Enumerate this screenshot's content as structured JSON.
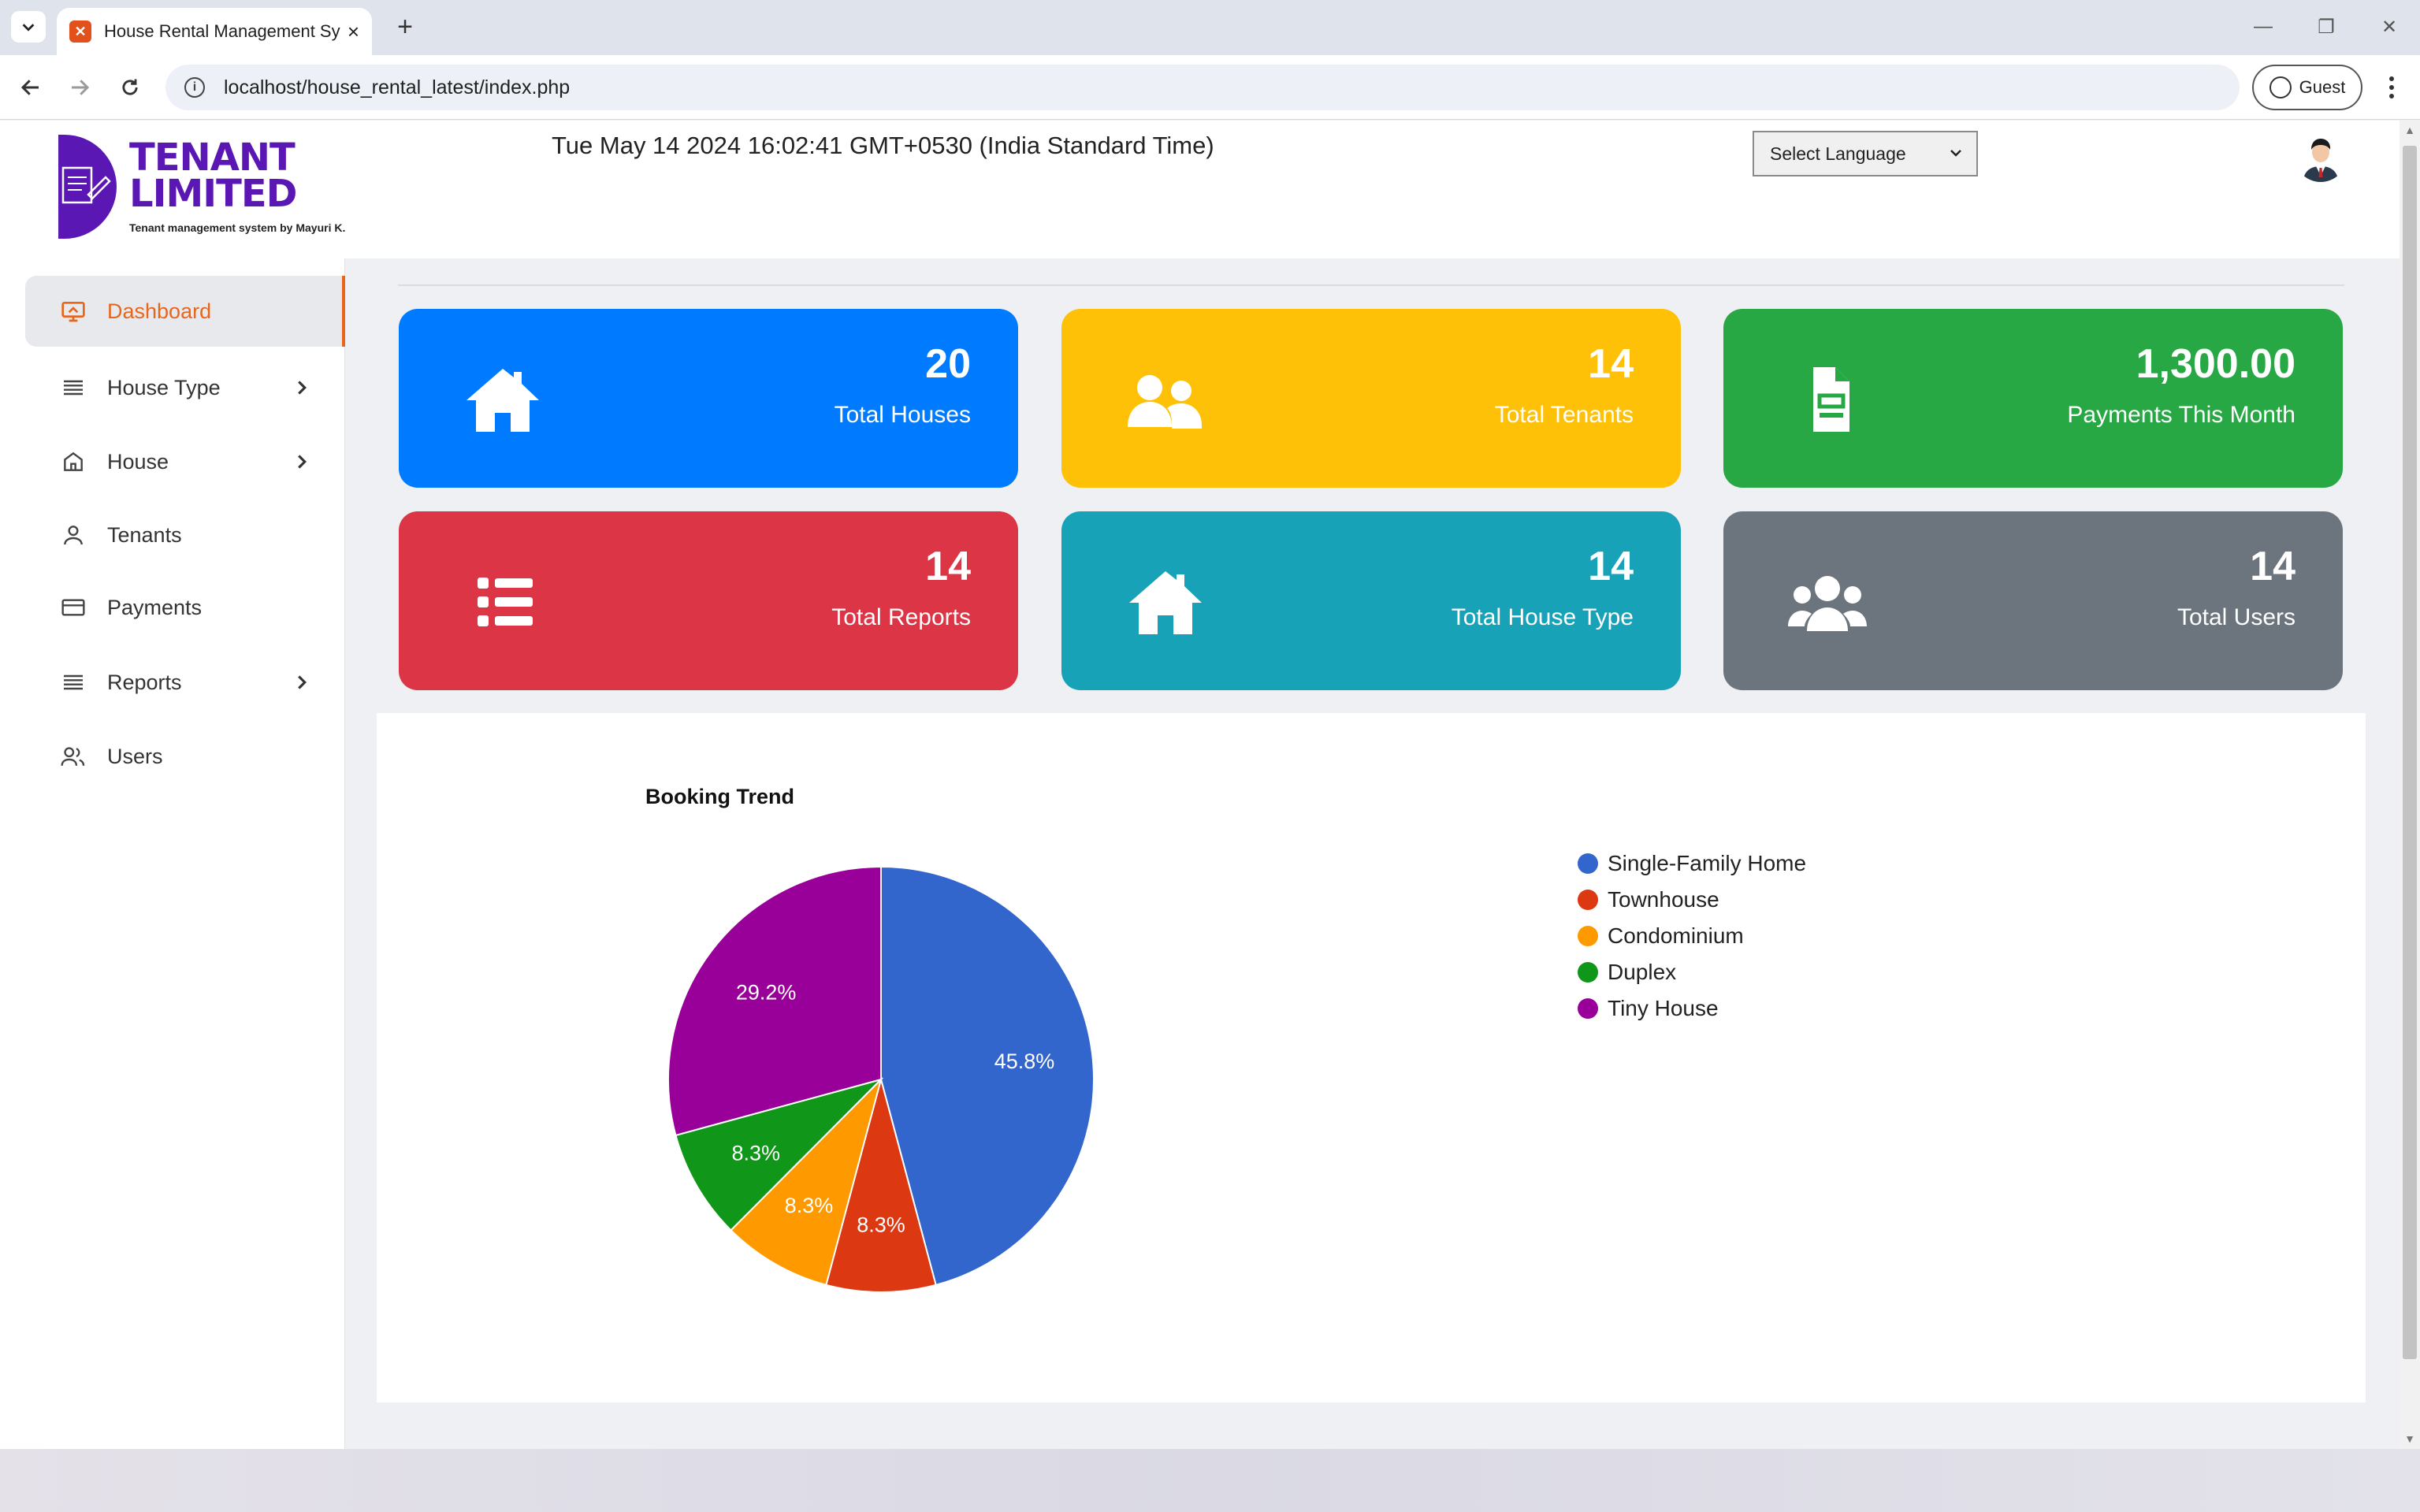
{
  "browser": {
    "tab_title": "House Rental Management System",
    "url": "localhost/house_rental_latest/index.php",
    "profile_label": "Guest"
  },
  "header": {
    "logo_line1": "TENANT",
    "logo_line2": "LIMITED",
    "logo_tagline": "Tenant management system by Mayuri K.",
    "datetime": "Tue May 14 2024 16:02:41 GMT+0530 (India Standard Time)",
    "language_select": "Select Language"
  },
  "sidebar": {
    "items": [
      {
        "label": "Dashboard",
        "icon": "monitor-icon",
        "active": true
      },
      {
        "label": "House Type",
        "icon": "list-icon",
        "has_submenu": true
      },
      {
        "label": "House",
        "icon": "home-icon",
        "has_submenu": true
      },
      {
        "label": "Tenants",
        "icon": "user-icon"
      },
      {
        "label": "Payments",
        "icon": "credit-card-icon"
      },
      {
        "label": "Reports",
        "icon": "list-icon",
        "has_submenu": true
      },
      {
        "label": "Users",
        "icon": "users-icon"
      }
    ]
  },
  "cards": [
    {
      "value": "20",
      "label": "Total Houses",
      "color": "#007bff",
      "icon": "home-icon"
    },
    {
      "value": "14",
      "label": "Total Tenants",
      "color": "#ffc107",
      "icon": "user-group-icon"
    },
    {
      "value": "1,300.00",
      "label": "Payments This Month",
      "color": "#28a745",
      "icon": "document-icon"
    },
    {
      "value": "14",
      "label": "Total Reports",
      "color": "#dc3545",
      "icon": "list-icon"
    },
    {
      "value": "14",
      "label": "Total House Type",
      "color": "#17a2b8",
      "icon": "home-icon"
    },
    {
      "value": "14",
      "label": "Total Users",
      "color": "#6c757d",
      "icon": "users-icon"
    }
  ],
  "chart_data": {
    "type": "pie",
    "title": "Booking Trend",
    "legend_position": "right",
    "slices": [
      {
        "label": "Single-Family Home",
        "value": 45.8,
        "display": "45.8%",
        "color": "#3366cc"
      },
      {
        "label": "Townhouse",
        "value": 8.3,
        "display": "8.3%",
        "color": "#dc3912"
      },
      {
        "label": "Condominium",
        "value": 8.3,
        "display": "8.3%",
        "color": "#ff9900"
      },
      {
        "label": "Duplex",
        "value": 8.3,
        "display": "8.3%",
        "color": "#109618"
      },
      {
        "label": "Tiny House",
        "value": 29.2,
        "display": "29.2%",
        "color": "#990099"
      }
    ]
  }
}
